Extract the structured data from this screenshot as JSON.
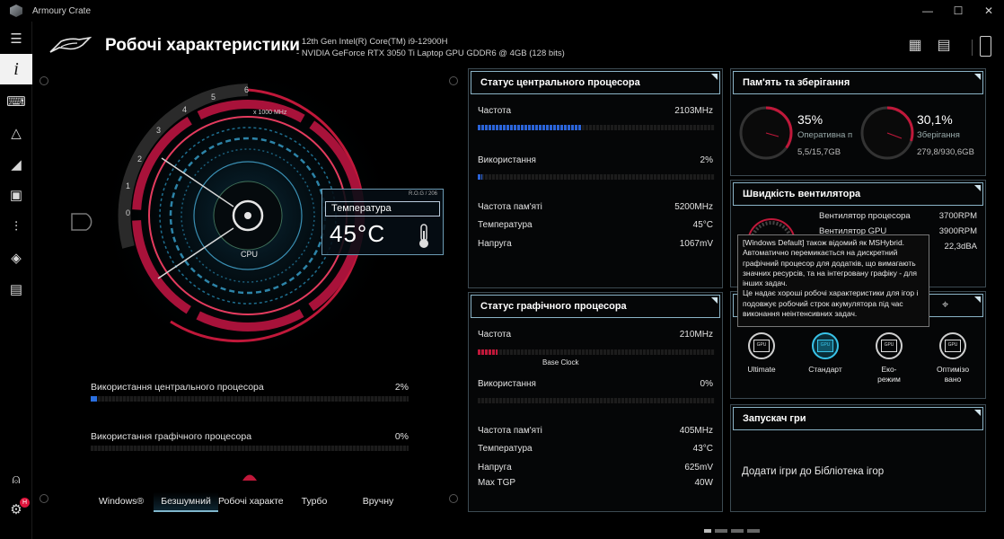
{
  "app": {
    "title": "Armoury Crate"
  },
  "window_controls": {
    "minimize": "—",
    "maximize": "☐",
    "close": "✕"
  },
  "header": {
    "title": "Робочі характеристики",
    "cpu_line": "12th Gen Intel(R) Core(TM) i9-12900H",
    "gpu_line": "NVIDIA GeForce RTX 3050 Ti Laptop GPU GDDR6 @ 4GB (128 bits)"
  },
  "gauge": {
    "scale_label": "x 1000 MHz",
    "ticks": [
      "0",
      "1",
      "2",
      "3",
      "4",
      "5",
      "6"
    ],
    "center_label": "CPU",
    "tag": "R.O.G / 206",
    "temp_label": "Температура",
    "temp_value": "45°C"
  },
  "utilization": {
    "cpu": {
      "label": "Використання центрального процесора",
      "value": "2%",
      "fraction": 0.02
    },
    "gpu": {
      "label": "Використання графічного процесора",
      "value": "0%",
      "fraction": 0.0
    }
  },
  "modes": {
    "items": [
      "Windows®",
      "Безшумний",
      "Робочі характеристики",
      "Турбо",
      "Вручну"
    ],
    "selected": "Безшумний"
  },
  "cpu_panel": {
    "title": "Статус центрального процесора",
    "freq_label": "Частота",
    "freq_value": "2103MHz",
    "freq_fraction": 0.44,
    "usage_label": "Використання",
    "usage_value": "2%",
    "usage_fraction": 0.02,
    "mem_freq_label": "Частота пам'яті",
    "mem_freq_value": "5200MHz",
    "temp_label": "Температура",
    "temp_value": "45°C",
    "volt_label": "Напруга",
    "volt_value": "1067mV"
  },
  "gpu_panel": {
    "title": "Статус графічного процесора",
    "freq_label": "Частота",
    "freq_value": "210MHz",
    "base_clock_label": "Base Clock",
    "usage_label": "Використання",
    "usage_value": "0%",
    "mem_freq_label": "Частота пам'яті",
    "mem_freq_value": "405MHz",
    "temp_label": "Температура",
    "temp_value": "43°C",
    "volt_label": "Напруга",
    "volt_value": "625mV",
    "tgp_label": "Max TGP",
    "tgp_value": "40W"
  },
  "memory_panel": {
    "title": "Пам'ять та зберігання",
    "ram": {
      "percent": "35%",
      "label": "Оперативна п",
      "value": "5,5/15,7GB",
      "fraction": 0.35
    },
    "storage": {
      "percent": "30,1%",
      "label": "Зберігання",
      "value": "279,8/930,6GB",
      "fraction": 0.301
    }
  },
  "fan_panel": {
    "title": "Швидкість вентилятора",
    "cpu_fan_label": "Вентилятор процесора",
    "cpu_fan_value": "3700RPM",
    "gpu_fan_label": "Вентилятор GPU",
    "gpu_fan_value": "3900RPM",
    "noise_value": "22,3dBA"
  },
  "tooltip": {
    "text1": "[Windows Default] також відомий як MSHybrid. Автоматично перемикається на дискретний графічний процесор для додатків, що вимагають значних ресурсів, та на інтегровану графіку - для інших задач.",
    "text2": "Це надає хороші робочі характеристики для ігор і подовжує робочий строк акумулятора під час виконання неінтенсивних задач."
  },
  "gpu_modes": {
    "chip_text": "GPU",
    "items": [
      "Ultimate",
      "Стандарт",
      "Еко-\nрежим",
      "Оптимізо\nвано"
    ],
    "selected_index": 1
  },
  "launcher_panel": {
    "title": "Запускач гри",
    "text": "Додати ігри до Бібліотека ігор"
  },
  "notifications": {
    "badge": "H"
  },
  "colors": {
    "accent": "#e0143c",
    "blue": "#2a6fe0",
    "cyan": "#39c3e8",
    "border": "#8ab3c6"
  },
  "icons": [
    "menu-icon",
    "info-icon",
    "keyboard-icon",
    "aura-icon",
    "armoury-icon",
    "game-library-icon",
    "tuning-icon",
    "deals-icon",
    "news-icon",
    "user-icon",
    "settings-icon",
    "layout-icon",
    "report-icon",
    "device-icon"
  ]
}
